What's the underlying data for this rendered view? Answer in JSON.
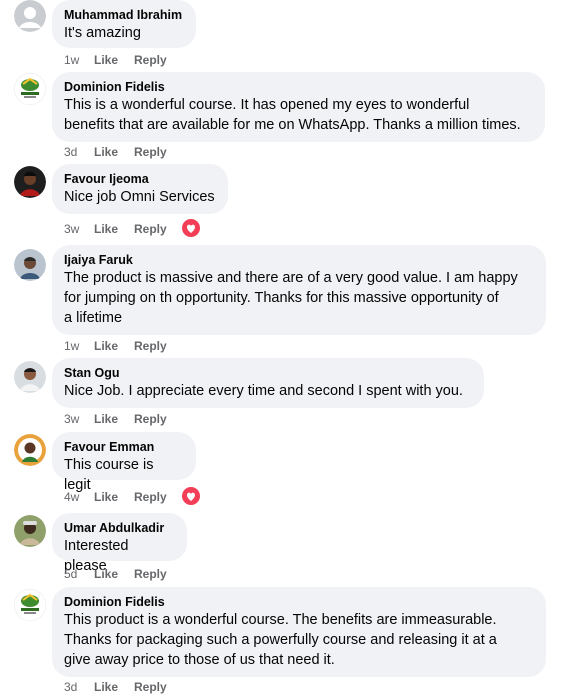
{
  "comments": [
    {
      "author": "Muhammad Ibrahim",
      "text": "It's amazing",
      "time": "1w",
      "like": "Like",
      "reply": "Reply",
      "avatar": "default-avatar",
      "reaction": ""
    },
    {
      "author": "Dominion Fidelis",
      "text": "This is a wonderful course. It has opened my eyes to wonderful\nbenefits that are available for me on WhatsApp. Thanks a million times.",
      "time": "3d",
      "like": "Like",
      "reply": "Reply",
      "avatar": "logo-avatar",
      "reaction": ""
    },
    {
      "author": "Favour Ijeoma",
      "text": "Nice job Omni Services",
      "time": "3w",
      "like": "Like",
      "reply": "Reply",
      "avatar": "photo-avatar",
      "reaction": "love"
    },
    {
      "author": "Ijaiya Faruk",
      "text": "The product is massive and there are of a very good value. I am happy\nfor jumping on th opportunity. Thanks for this massive opportunity of\na lifetime",
      "time": "1w",
      "like": "Like",
      "reply": "Reply",
      "avatar": "photo-avatar",
      "reaction": ""
    },
    {
      "author": "Stan Ogu",
      "text": "Nice Job. I appreciate every time and second I spent with you.",
      "time": "3w",
      "like": "Like",
      "reply": "Reply",
      "avatar": "photo-avatar",
      "reaction": ""
    },
    {
      "author": "Favour Emman",
      "text": "This course is legit",
      "time": "4w",
      "like": "Like",
      "reply": "Reply",
      "avatar": "photo-avatar",
      "reaction": "love"
    },
    {
      "author": "Umar Abdulkadir",
      "text": "Interested please",
      "time": "5d",
      "like": "Like",
      "reply": "Reply",
      "avatar": "photo-avatar",
      "reaction": ""
    },
    {
      "author": "Dominion Fidelis",
      "text": "This product is a wonderful course. The benefits are immeasurable.\nThanks for packaging such a powerfully course and releasing it at a\ngive away price to those of us that need it.",
      "time": "3d",
      "like": "Like",
      "reply": "Reply",
      "avatar": "logo-avatar",
      "reaction": ""
    }
  ],
  "colors": {
    "bubble": "#f0f2f5",
    "meta_text": "#65676b",
    "love_reaction": "#f33e58"
  }
}
